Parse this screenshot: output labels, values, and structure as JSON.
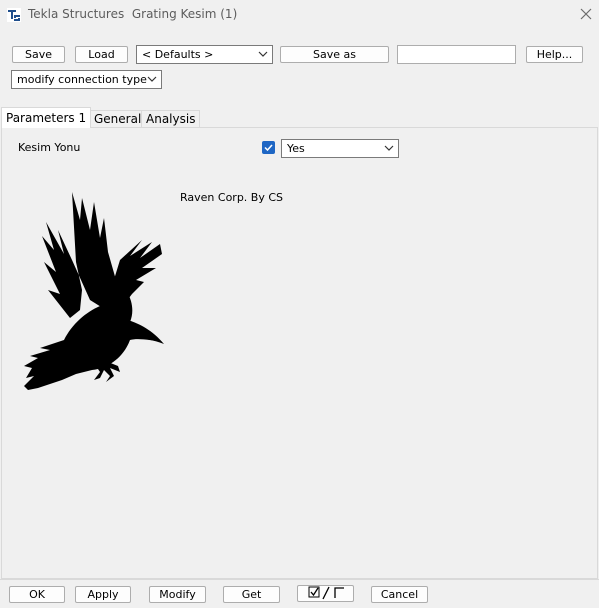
{
  "titlebar": {
    "app_name": "Tekla Structures",
    "dialog_name": "Grating Kesim (1)",
    "icon": "tekla-app-icon",
    "close_icon": "close-icon"
  },
  "toolbar": {
    "save_label": "Save",
    "load_label": "Load",
    "preset_value": "< Defaults >",
    "save_as_label": "Save as",
    "save_as_input_value": "",
    "help_label": "Help...",
    "mode_value": "modify connection type"
  },
  "tabs": [
    {
      "label": "Parameters 1",
      "active": true
    },
    {
      "label": "General",
      "active": false
    },
    {
      "label": "Analysis",
      "active": false
    }
  ],
  "params": {
    "kesim_label": "Kesim Yonu",
    "kesim_checked": true,
    "kesim_value": "Yes",
    "credit_text": "Raven Corp. By CS",
    "image": "raven-silhouette"
  },
  "footer": {
    "ok_label": "OK",
    "apply_label": "Apply",
    "modify_label": "Modify",
    "get_label": "Get",
    "toggle_icon": "check-toggle-icon",
    "cancel_label": "Cancel"
  },
  "colors": {
    "checkbox_accent": "#1e66c4",
    "tekla_blue": "#1f4e8c"
  }
}
